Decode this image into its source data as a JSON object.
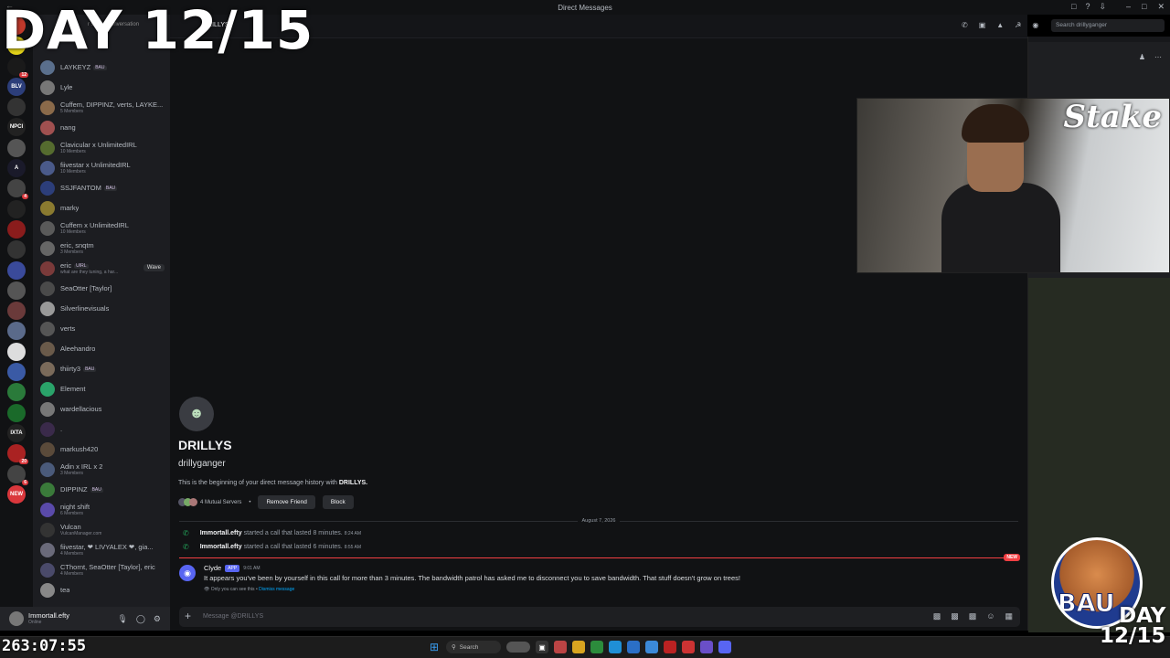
{
  "window": {
    "title": "Direct Messages"
  },
  "header": {
    "channel_name": "DRILLYS",
    "search_placeholder": "Search drillyganger",
    "find_prompt": "r start a conversation"
  },
  "servers": [
    {
      "label": "",
      "color": "#c0392b"
    },
    {
      "label": "",
      "color": "#e2d21a"
    },
    {
      "label": "",
      "color": "#1a1a1a",
      "badge": "12"
    },
    {
      "label": "BLV",
      "color": "#2c3e7a"
    },
    {
      "label": "",
      "color": "#333"
    },
    {
      "label": "NPCI",
      "color": "#222"
    },
    {
      "label": "",
      "color": "#555"
    },
    {
      "label": "A",
      "color": "#1a1a2a"
    },
    {
      "label": "",
      "color": "#444",
      "badge": "4"
    },
    {
      "label": "",
      "color": "#222"
    },
    {
      "label": "",
      "color": "#8a1c1c"
    },
    {
      "label": "",
      "color": "#333"
    },
    {
      "label": "",
      "color": "#3a4a9a"
    },
    {
      "label": "",
      "color": "#555"
    },
    {
      "label": "",
      "color": "#6a3a3a"
    },
    {
      "label": "",
      "color": "#5a6a8a"
    },
    {
      "label": "",
      "color": "#ddd"
    },
    {
      "label": "",
      "color": "#3a5aa5"
    },
    {
      "label": "",
      "color": "#2a7a3a"
    },
    {
      "label": "",
      "color": "#1a6a2a"
    },
    {
      "label": "IXTA",
      "color": "#222"
    },
    {
      "label": "",
      "color": "#aa2222",
      "badge": "20"
    },
    {
      "label": "",
      "color": "#444",
      "badge": "6"
    },
    {
      "label": "NEW",
      "color": "#da373c"
    }
  ],
  "dms": [
    {
      "name": "LAYKEYZ",
      "sub": "",
      "tag": "BAU"
    },
    {
      "name": "Lyle",
      "sub": "",
      "tag": ""
    },
    {
      "name": "Cuffem, DIPPINZ, verts, LAYKE...",
      "sub": "5 Members",
      "tag": ""
    },
    {
      "name": "nang",
      "sub": "",
      "tag": ""
    },
    {
      "name": "Clavicular x UnlimitedIRL",
      "sub": "10 Members",
      "tag": ""
    },
    {
      "name": "fiivestar x UnlimitedIRL",
      "sub": "10 Members",
      "tag": ""
    },
    {
      "name": "SSJFANTOM",
      "sub": "",
      "tag": "BAU"
    },
    {
      "name": "marky",
      "sub": "",
      "tag": ""
    },
    {
      "name": "Cuffem x UnlimitedIRL",
      "sub": "10 Members",
      "tag": ""
    },
    {
      "name": "eric, snqtm",
      "sub": "3 Members",
      "tag": ""
    },
    {
      "name": "eric",
      "sub": "what are they tuning, a har...",
      "tag": "UIRL",
      "wave": "Wave"
    },
    {
      "name": "SeaOtter [Taylor]",
      "sub": "",
      "tag": ""
    },
    {
      "name": "Silverlinevisuals",
      "sub": "",
      "tag": ""
    },
    {
      "name": "verts",
      "sub": "",
      "tag": ""
    },
    {
      "name": "Aleehandro",
      "sub": "",
      "tag": ""
    },
    {
      "name": "thiirty3",
      "sub": "",
      "tag": "BAU"
    },
    {
      "name": "Element",
      "sub": "",
      "tag": ""
    },
    {
      "name": "wardellacious",
      "sub": "",
      "tag": ""
    },
    {
      "name": ".",
      "sub": "",
      "tag": ""
    },
    {
      "name": "markush420",
      "sub": "",
      "tag": ""
    },
    {
      "name": "Adin x IRL x 2",
      "sub": "3 Members",
      "tag": ""
    },
    {
      "name": "DIPPINZ",
      "sub": "",
      "tag": "BAU"
    },
    {
      "name": "night shift",
      "sub": "6 Members",
      "tag": ""
    },
    {
      "name": "Vulcan",
      "sub": "VulcanManager.com",
      "tag": ""
    },
    {
      "name": "fiivestar, ❤ LIVYALEX ❤, gia...",
      "sub": "4 Members",
      "tag": ""
    },
    {
      "name": "CThornt, SeaOtter [Taylor], eric",
      "sub": "4 Members",
      "tag": ""
    },
    {
      "name": "tea",
      "sub": "",
      "tag": ""
    }
  ],
  "user": {
    "name": "Immortall.efty",
    "status": "Online"
  },
  "intro": {
    "display_name": "DRILLYS",
    "username": "drillyganger",
    "beginning_prefix": "This is the beginning of your direct message history with ",
    "beginning_name": "DRILLYS.",
    "mutual_servers": "4 Mutual Servers",
    "remove_friend": "Remove Friend",
    "block": "Block"
  },
  "date_divider": "August 7, 2026",
  "calls": [
    {
      "user": "Immortall.efty",
      "text": "started a call that lasted 8 minutes.",
      "time": "8:24 AM"
    },
    {
      "user": "Immortall.efty",
      "text": "started a call that lasted 6 minutes.",
      "time": "8:55 AM"
    }
  ],
  "new_label": "NEW",
  "clyde": {
    "name": "Clyde",
    "tag": "APP",
    "time": "9:01 AM",
    "message": "It appears you've been by yourself in this call for more than 3 minutes. The bandwidth patrol has asked me to disconnect you to save bandwidth. That stuff doesn't grow on trees!",
    "note": "Only you can see this • ",
    "dismiss": "Dismiss message"
  },
  "composer": {
    "placeholder": "Message @DRILLYS"
  },
  "overlay": {
    "day_counter": "DAY 12/15",
    "stream_timer": "263:07:55",
    "sponsor": "Stake",
    "logo_text": "BAU",
    "day_small_1": "DAY",
    "day_small_2": "12/15"
  },
  "taskbar": {
    "search_label": "Search"
  }
}
